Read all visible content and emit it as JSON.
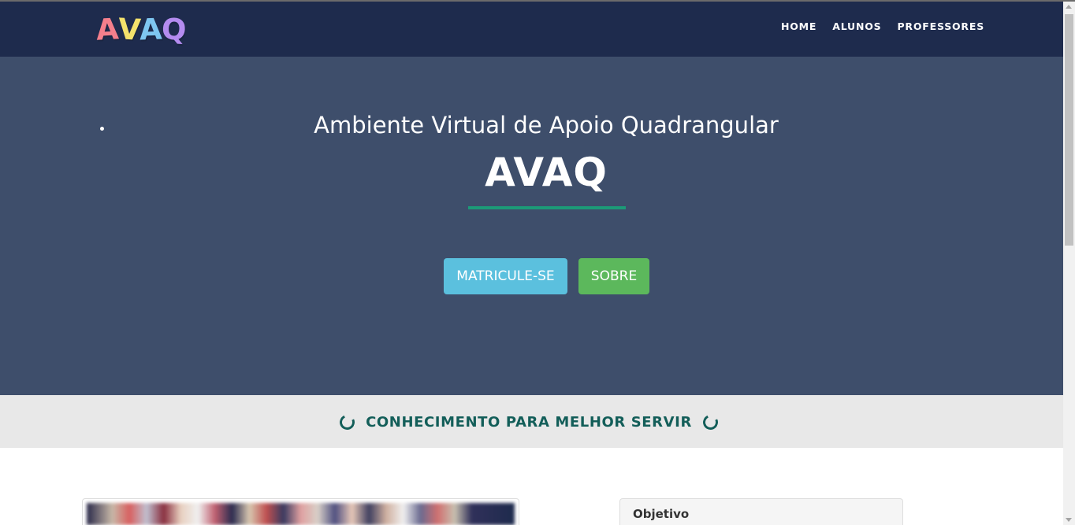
{
  "navbar": {
    "logo_letters": [
      "A",
      "V",
      "A",
      "Q"
    ],
    "logo_colors": [
      "#f47f8c",
      "#f4e26c",
      "#7ec6f0",
      "#b48cf0"
    ],
    "links": [
      {
        "label": "HOME"
      },
      {
        "label": "ALUNOS"
      },
      {
        "label": "PROFESSORES"
      }
    ],
    "background": "#1e2b4d"
  },
  "hero": {
    "subtitle": "Ambiente Virtual de Apoio Quadrangular",
    "title": "AVAQ",
    "underline_color": "#1c9a77",
    "background": "#3e4e6b",
    "buttons": {
      "matricule_label": "MATRICULE-SE",
      "sobre_label": "SOBRE"
    }
  },
  "slogan": {
    "text": "CONHECIMENTO PARA MELHOR SERVIR",
    "color": "#135e59",
    "icon": "spinner-icon"
  },
  "content": {
    "objective_title": "Objetivo"
  }
}
